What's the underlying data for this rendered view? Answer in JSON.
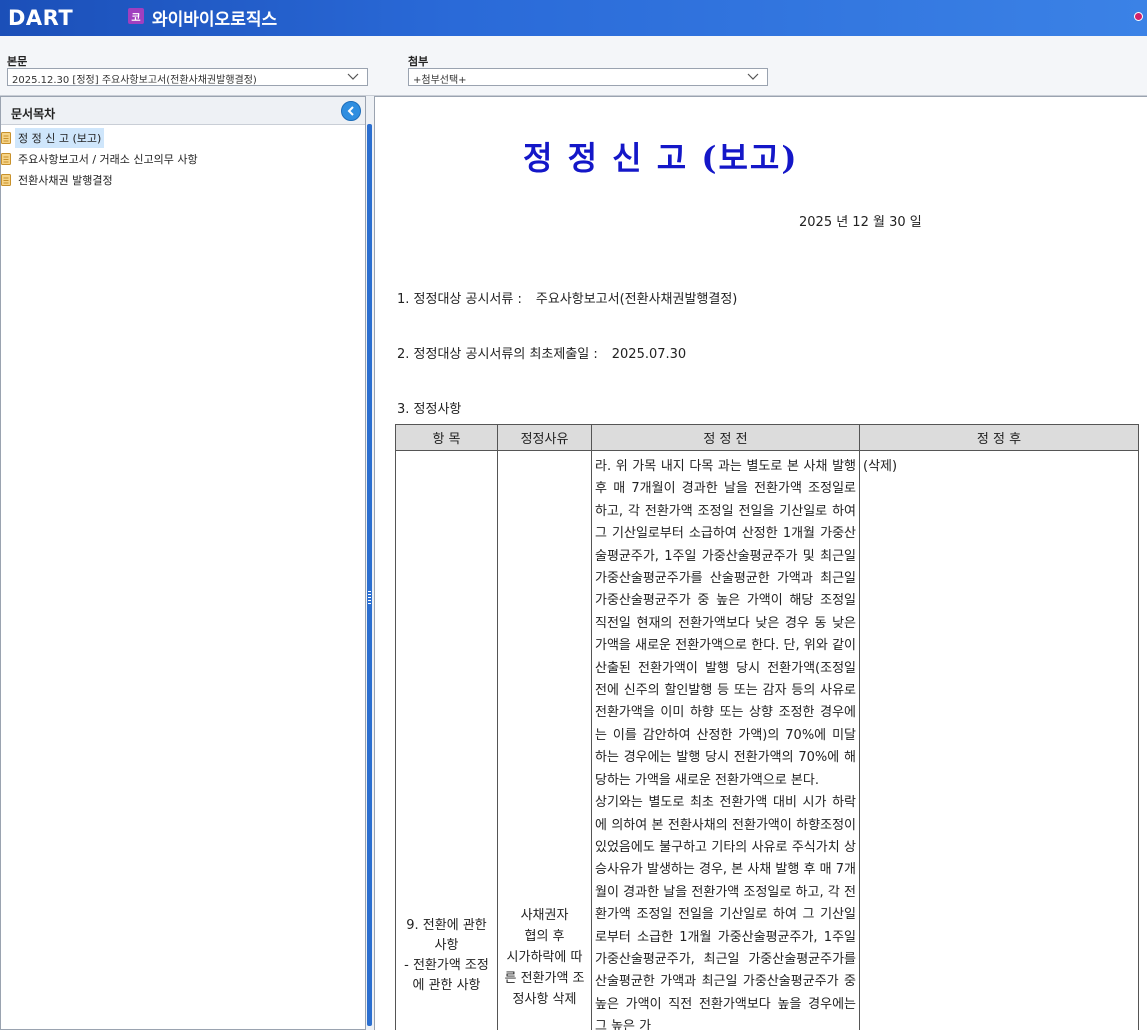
{
  "header": {
    "logo": "DART",
    "company_badge": "코",
    "company_name": "와이바이오로직스"
  },
  "selectors": {
    "main": {
      "label": "본문",
      "value": "2025.12.30  [정정] 주요사항보고서(전환사채권발행결정)"
    },
    "attach": {
      "label": "첨부",
      "value": "+첨부선택+"
    }
  },
  "toc": {
    "title": "문서목차",
    "items": [
      {
        "label": "정 정 신 고 (보고)",
        "selected": true
      },
      {
        "label": "주요사항보고서 / 거래소 신고의무 사항",
        "selected": false
      },
      {
        "label": "전환사채권 발행결정",
        "selected": false
      }
    ]
  },
  "document": {
    "title": "정 정 신 고 (보고)",
    "date": "2025 년 12 월 30 일",
    "item1": {
      "label": "1. 정정대상 공시서류 :",
      "value": "주요사항보고서(전환사채권발행결정)"
    },
    "item2": {
      "label": "2. 정정대상 공시서류의 최초제출일 :",
      "value": "2025.07.30"
    },
    "item3": {
      "label": "3. 정정사항"
    },
    "table": {
      "headers": [
        "항  목",
        "정정사유",
        "정 정 전",
        "정 정 후"
      ],
      "row": {
        "item_line1": "9. 전환에 관한",
        "item_line2": "사항",
        "item_line3": "- 전환가액 조정",
        "item_line4": "에 관한 사항",
        "reason_line1": "사채권자",
        "reason_line2": "협의 후",
        "reason_line3": "시가하락에 따",
        "reason_line4": "른 전환가액 조",
        "reason_line5": "정사항 삭제",
        "before_p1": "라. 위 가목 내지 다목 과는 별도로 본 사채 발행 후 매 7개월이 경과한 날을 전환가액 조정일로 하고, 각 전환가액 조정일 전일을 기산일로 하여 그 기산일로부터 소급하여 산정한 1개월 가중산술평균주가, 1주일 가중산술평균주가 및 최근일 가중산술평균주가를 산술평균한 가액과 최근일 가중산술평균주가 중 높은 가액이 해당 조정일 직전일 현재의 전환가액보다 낮은 경우 동 낮은 가액을 새로운 전환가액으로 한다. 단, 위와 같이 산출된 전환가액이 발행 당시 전환가액(조정일 전에 신주의 할인발행 등 또는 감자 등의 사유로 전환가액을 이미 하향 또는 상향 조정한 경우에는 이를 감안하여 산정한 가액)의 70%에 미달하는 경우에는 발행 당시 전환가액의 70%에 해당하는 가액을 새로운 전환가액으로 본다.",
        "before_p2": "상기와는 별도로 최초 전환가액 대비 시가 하락에 의하여 본 전환사채의 전환가액이 하향조정이 있었음에도 불구하고 기타의 사유로 주식가치 상승사유가 발생하는 경우, 본 사채 발행 후 매 7개월이 경과한 날을 전환가액 조정일로 하고, 각 전환가액 조정일 전일을 기산일로 하여 그 기산일로부터 소급한 1개월 가중산술평균주가, 1주일 가중산술평균주가, 최근일 가중산술평균주가를 산술평균한 가액과 최근일 가중산술평균주가 중 높은 가액이 직전 전환가액보다 높을 경우에는 그 높은 가",
        "after": "(삭제)"
      }
    }
  },
  "colors": {
    "header_start": "#1b4fb8",
    "header_end": "#3b82e6",
    "title_blue": "#1417c8",
    "toc_selected": "#cfe6fb",
    "table_header": "#dcdcdc"
  }
}
